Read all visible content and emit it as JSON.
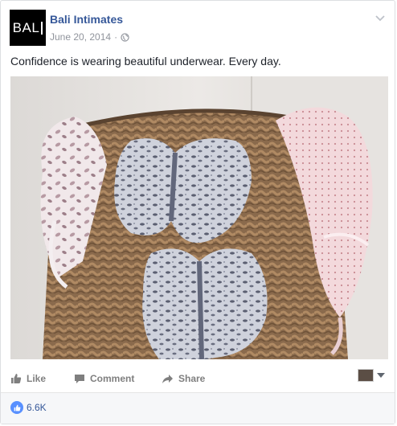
{
  "post": {
    "page_name": "Bali Intimates",
    "avatar_text": "BAL",
    "date": "June 20, 2014",
    "separator": "·",
    "caption": "Confidence is wearing beautiful underwear. Every day.",
    "icons": {
      "privacy": "globe-icon",
      "options": "chevron-down-icon"
    }
  },
  "actions": {
    "like_label": "Like",
    "comment_label": "Comment",
    "share_label": "Share"
  },
  "footer": {
    "like_count": "6.6K"
  },
  "colors": {
    "link": "#365899",
    "muted": "#90949c",
    "action": "#7f7f7f",
    "like_badge": "#5890ff",
    "footer_bg": "#f6f7f9"
  }
}
